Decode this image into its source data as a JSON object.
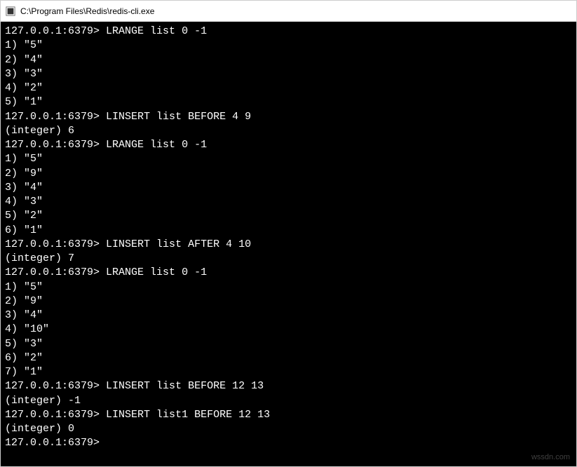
{
  "window": {
    "title": "C:\\Program Files\\Redis\\redis-cli.exe"
  },
  "prompt": "127.0.0.1:6379>",
  "sessions": [
    {
      "command": "LRANGE list 0 -1",
      "output": [
        "1) \"5\"",
        "2) \"4\"",
        "3) \"3\"",
        "4) \"2\"",
        "5) \"1\""
      ]
    },
    {
      "command": "LINSERT list BEFORE 4 9",
      "output": [
        "(integer) 6"
      ]
    },
    {
      "command": "LRANGE list 0 -1",
      "output": [
        "1) \"5\"",
        "2) \"9\"",
        "3) \"4\"",
        "4) \"3\"",
        "5) \"2\"",
        "6) \"1\""
      ]
    },
    {
      "command": "LINSERT list AFTER 4 10",
      "output": [
        "(integer) 7"
      ]
    },
    {
      "command": "LRANGE list 0 -1",
      "output": [
        "1) \"5\"",
        "2) \"9\"",
        "3) \"4\"",
        "4) \"10\"",
        "5) \"3\"",
        "6) \"2\"",
        "7) \"1\""
      ]
    },
    {
      "command": "LINSERT list BEFORE 12 13",
      "output": [
        "(integer) -1"
      ]
    },
    {
      "command": "LINSERT list1 BEFORE 12 13",
      "output": [
        "(integer) 0"
      ]
    }
  ],
  "trailing_prompt": true,
  "watermark": "wssdn.com"
}
